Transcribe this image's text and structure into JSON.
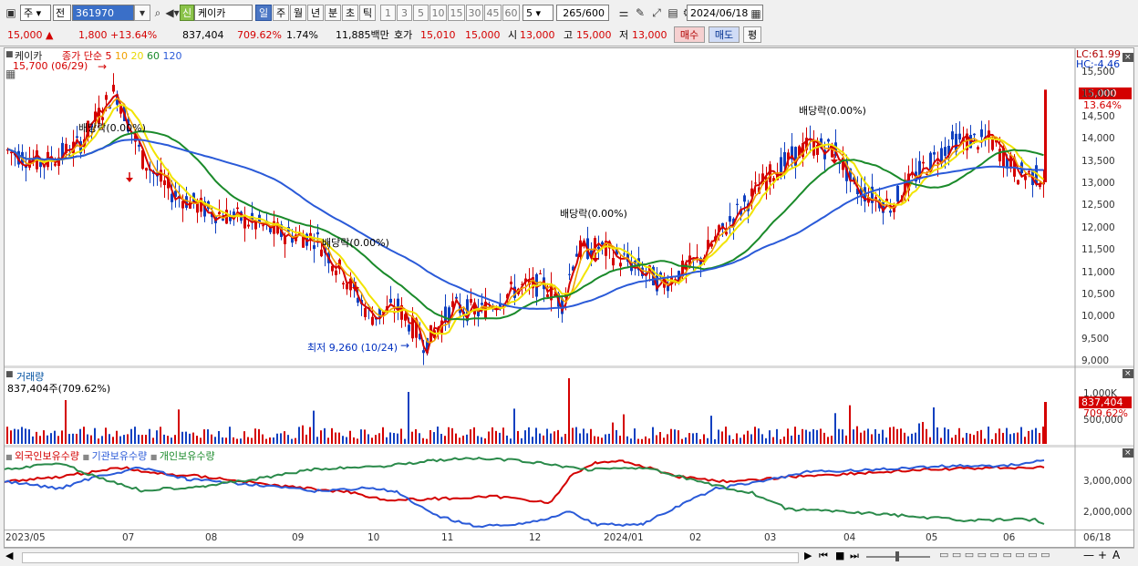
{
  "toolbar": {
    "period": "주",
    "prefix": "전",
    "code": "361970",
    "badge": "신",
    "name": "케이카",
    "periods": [
      "일",
      "주",
      "월",
      "년",
      "분",
      "초",
      "틱"
    ],
    "nums": [
      "1",
      "3",
      "5",
      "10",
      "15",
      "30",
      "45",
      "60"
    ],
    "n_value": "5",
    "count": "265",
    "count_total": "/600",
    "date": "2024/06/18"
  },
  "quote": {
    "price": "15,000",
    "change": "1,800",
    "change_pct": "+13.64%",
    "volume": "837,404",
    "vol_ratio": "709.62%",
    "turnover": "1.74%",
    "amount": "11,885백만",
    "bid_label": "호가",
    "bid": "15,010",
    "ask": "15,000",
    "open_label": "시",
    "open": "13,000",
    "high_label": "고",
    "high": "15,000",
    "low_label": "저",
    "low": "13,000",
    "buy": "매수",
    "sell": "매도",
    "avg": "평"
  },
  "chart_data": [
    {
      "type": "candlestick",
      "name": "케이카",
      "legend": [
        "종가 단순 5",
        "10",
        "20",
        "60",
        "120"
      ],
      "legend_colors": [
        "#d40000",
        "#f0a000",
        "#e8d800",
        "#1a8a2a",
        "#2a5ad8"
      ],
      "yticks": [
        "15,500",
        "15,000",
        "14,500",
        "14,000",
        "13,500",
        "13,000",
        "12,500",
        "12,000",
        "11,500",
        "11,000",
        "10,500",
        "10,000",
        "9,500",
        "9,000"
      ],
      "ylim": [
        9000,
        15500
      ],
      "current_price_tag": "15,000",
      "current_pct_tag": "13.64%",
      "top_right": [
        "LC:61.99",
        "HC:-4.46"
      ],
      "annotations": [
        {
          "text": "15,700 (06/29)"
        },
        {
          "text": "최저 9,260 (10/24)"
        },
        {
          "text": "배당락(0.00%)"
        },
        {
          "text": "배당락(0.00%)"
        },
        {
          "text": "배당락(0.00%)"
        },
        {
          "text": "배당락(0.00%)"
        }
      ]
    },
    {
      "type": "bar",
      "name": "거래량",
      "subtitle": "837,404주(709.62%)",
      "yticks": [
        "1,000K",
        "500,000"
      ],
      "tag_value": "837,404",
      "tag_pct": "709.62%"
    },
    {
      "type": "line",
      "series": [
        {
          "name": "외국인보유수량",
          "color": "#d40000"
        },
        {
          "name": "기관보유수량",
          "color": "#2a5ad8"
        },
        {
          "name": "개인보유수량",
          "color": "#1a8a2a"
        }
      ],
      "yticks": [
        "3,000,000",
        "2,000,000"
      ]
    }
  ],
  "xaxis": [
    "2023/05",
    "07",
    "08",
    "09",
    "10",
    "11",
    "12",
    "2024/01",
    "02",
    "03",
    "04",
    "05",
    "06",
    "06/18"
  ]
}
